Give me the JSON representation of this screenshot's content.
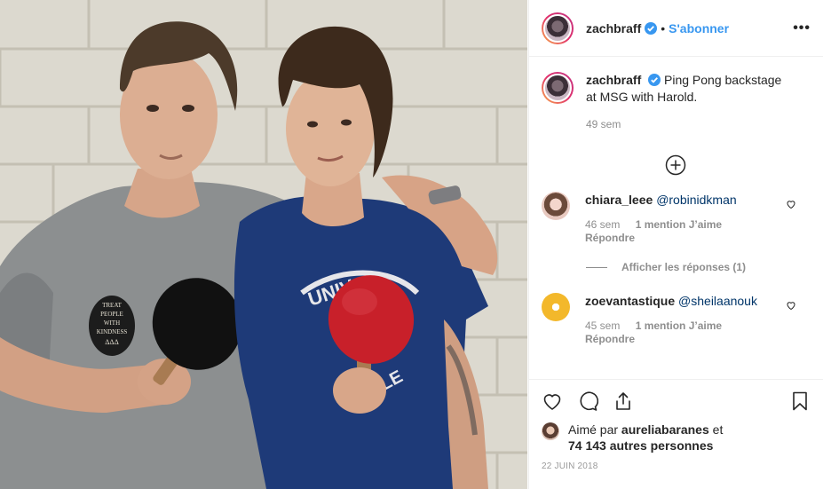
{
  "post": {
    "username": "zachbraff",
    "follow_label": "S'abonner",
    "dot": "•",
    "more_label": "•••",
    "caption": "Ping Pong backstage at MSG with Harold.",
    "caption_time": "49 sem",
    "date": "22 JUIN 2018"
  },
  "comments": [
    {
      "username": "chiara_leee",
      "text": "@robinidkman",
      "time": "46 sem",
      "likes": "1 mention J’aime",
      "reply": "Répondre",
      "view_replies": "Afficher les réponses (1)"
    },
    {
      "username": "zoevantastique",
      "text": "@sheilaanouk",
      "time": "45 sem",
      "likes": "1 mention J’aime",
      "reply": "Répondre"
    }
  ],
  "likes_block": {
    "prefix": "Aimé par ",
    "user": "aureliabaranes",
    "mid": " et",
    "count": "74 143 autres personnes"
  },
  "photo": {
    "badge_lines": [
      "TREAT",
      "PEOPLE",
      "WITH",
      "KINDNESS",
      "ΔΔΔ"
    ],
    "shirt_text_top": "UNIV",
    "shirt_text_bottom": "VILLE"
  },
  "colors": {
    "accent": "#3897f0",
    "verified": "#3897f0",
    "paddle_red": "#c8202a",
    "paddle_black": "#111111"
  },
  "icons": [
    "more-icon",
    "verified-icon",
    "add-comment-icon",
    "heart-icon",
    "comment-icon",
    "share-icon",
    "bookmark-icon"
  ]
}
